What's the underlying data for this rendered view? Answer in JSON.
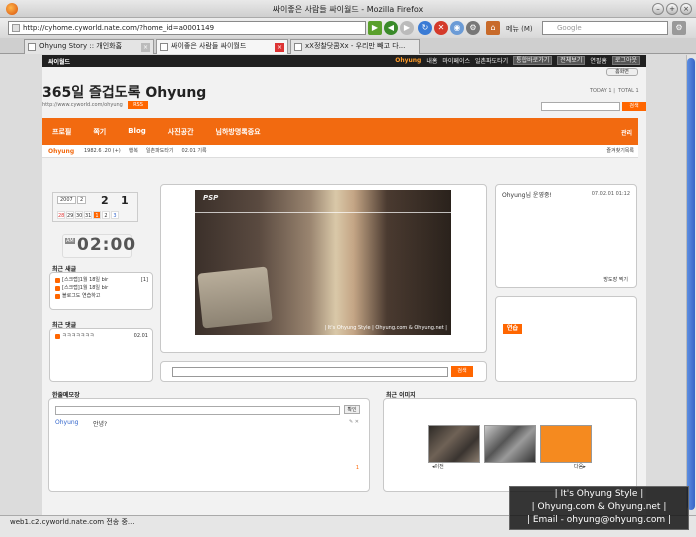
{
  "window": {
    "title": "싸이좋은 사람들 싸이월드 - Mozilla Firefox"
  },
  "nav": {
    "url": "http://cyhome.cyworld.nate.com/?home_id=a0001149",
    "search_placeholder": "Google",
    "menu_label": "메뉴 (M)"
  },
  "tabs": [
    {
      "label": "Ohyung Story :: 개인화홈"
    },
    {
      "label": "싸이좋은 사람들 싸이월드"
    },
    {
      "label": "xX정찰닷콤Xx - 우리만 빼고 다..."
    }
  ],
  "site": {
    "logo": "싸이월드",
    "user": "Ohyung",
    "links": [
      "내홈",
      "마이페이스",
      "일촌파도타기"
    ],
    "btn_links": [
      "통합바로가기",
      "전체보기"
    ],
    "extra": "연필홈",
    "logout": "로그아웃",
    "home_btn": "홈화면"
  },
  "blog": {
    "title": "365일 즐겁도록 Ohyung",
    "url": "http://www.cyworld.com/ohyung",
    "rss": "RSS",
    "today": "TODAY  1",
    "total": "TOTAL  1",
    "search_btn": "검색"
  },
  "menu": {
    "items": [
      "프로필",
      "쪽기",
      "Blog",
      "사진공간",
      "님하방명록중요"
    ],
    "admin": "관리"
  },
  "subbar": {
    "owner": "Ohyung",
    "info": "1982.6 .20 (+)",
    "status": "행복",
    "pado": "일촌파도타기",
    "record": "02.01 기록",
    "right": "즐겨찾기목록"
  },
  "calendar": {
    "year": "2007",
    "month_sel": "2",
    "month": "2",
    "day": "1",
    "days": [
      "28",
      "29",
      "30",
      "31",
      "1",
      "2",
      "3"
    ]
  },
  "clock": {
    "ampm": "AM",
    "time": "02:00"
  },
  "recent_posts": {
    "title": "최근 새글",
    "items": [
      "[스크랩]1월 18일 bir",
      "[스크랩]1월 18일 bir",
      "블로그도 연습하고"
    ],
    "count": "[1]"
  },
  "recent_comments": {
    "title": "최근 댓글",
    "items": [
      {
        "text": "ㅋㅋㅋㅋㅋㅋㅋ",
        "date": "02.01"
      }
    ]
  },
  "photo": {
    "logo": "PSP",
    "caption": "| It's Ohyung Style | Ohyung.com & Ohyung.net |"
  },
  "mid_search": {
    "btn": "검색"
  },
  "guestbook": {
    "header": "Ohyung님 운영중!",
    "date": "07.02.01 01:12",
    "footer": "방도장 찍기"
  },
  "rightbox2": {
    "badge": "연습"
  },
  "memo": {
    "title": "한줄메모장",
    "btn": "확인",
    "entries": [
      {
        "name": "Ohyung",
        "message": "안녕?"
      }
    ],
    "page": "1"
  },
  "recent_images": {
    "title": "최근 이미지",
    "prev": "이전",
    "next": "다음"
  },
  "status": "web1.c2.cyworld.nate.com 전송 중...",
  "overlay": {
    "line1": "| It's Ohyung Style |",
    "line2": "| Ohyung.com & Ohyung.net |",
    "line3": "| Email - ohyung@ohyung.com |"
  }
}
